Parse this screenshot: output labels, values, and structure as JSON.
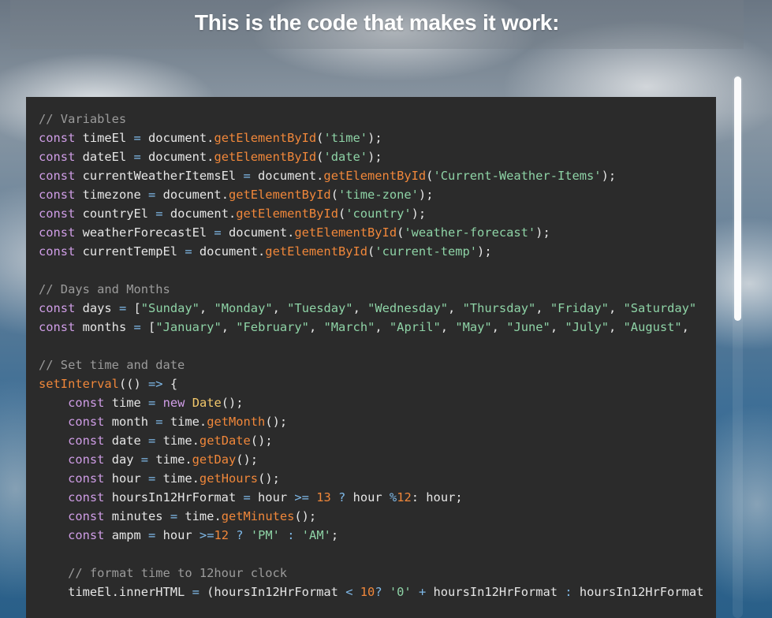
{
  "header": {
    "title": "This is the code that makes it work:"
  },
  "code": {
    "lines": [
      [
        {
          "t": "// Variables",
          "c": "comment"
        }
      ],
      [
        {
          "t": "const",
          "c": "keyword"
        },
        {
          "t": " timeEl ",
          "c": "plain"
        },
        {
          "t": "=",
          "c": "op"
        },
        {
          "t": " document.",
          "c": "plain"
        },
        {
          "t": "getElementById",
          "c": "fn"
        },
        {
          "t": "(",
          "c": "plain"
        },
        {
          "t": "'time'",
          "c": "string"
        },
        {
          "t": ");",
          "c": "plain"
        }
      ],
      [
        {
          "t": "const",
          "c": "keyword"
        },
        {
          "t": " dateEl ",
          "c": "plain"
        },
        {
          "t": "=",
          "c": "op"
        },
        {
          "t": " document.",
          "c": "plain"
        },
        {
          "t": "getElementById",
          "c": "fn"
        },
        {
          "t": "(",
          "c": "plain"
        },
        {
          "t": "'date'",
          "c": "string"
        },
        {
          "t": ");",
          "c": "plain"
        }
      ],
      [
        {
          "t": "const",
          "c": "keyword"
        },
        {
          "t": " currentWeatherItemsEl ",
          "c": "plain"
        },
        {
          "t": "=",
          "c": "op"
        },
        {
          "t": " document.",
          "c": "plain"
        },
        {
          "t": "getElementById",
          "c": "fn"
        },
        {
          "t": "(",
          "c": "plain"
        },
        {
          "t": "'Current-Weather-Items'",
          "c": "string"
        },
        {
          "t": ");",
          "c": "plain"
        }
      ],
      [
        {
          "t": "const",
          "c": "keyword"
        },
        {
          "t": " timezone ",
          "c": "plain"
        },
        {
          "t": "=",
          "c": "op"
        },
        {
          "t": " document.",
          "c": "plain"
        },
        {
          "t": "getElementById",
          "c": "fn"
        },
        {
          "t": "(",
          "c": "plain"
        },
        {
          "t": "'time-zone'",
          "c": "string"
        },
        {
          "t": ");",
          "c": "plain"
        }
      ],
      [
        {
          "t": "const",
          "c": "keyword"
        },
        {
          "t": " countryEl ",
          "c": "plain"
        },
        {
          "t": "=",
          "c": "op"
        },
        {
          "t": " document.",
          "c": "plain"
        },
        {
          "t": "getElementById",
          "c": "fn"
        },
        {
          "t": "(",
          "c": "plain"
        },
        {
          "t": "'country'",
          "c": "string"
        },
        {
          "t": ");",
          "c": "plain"
        }
      ],
      [
        {
          "t": "const",
          "c": "keyword"
        },
        {
          "t": " weatherForecastEl ",
          "c": "plain"
        },
        {
          "t": "=",
          "c": "op"
        },
        {
          "t": " document.",
          "c": "plain"
        },
        {
          "t": "getElementById",
          "c": "fn"
        },
        {
          "t": "(",
          "c": "plain"
        },
        {
          "t": "'weather-forecast'",
          "c": "string"
        },
        {
          "t": ");",
          "c": "plain"
        }
      ],
      [
        {
          "t": "const",
          "c": "keyword"
        },
        {
          "t": " currentTempEl ",
          "c": "plain"
        },
        {
          "t": "=",
          "c": "op"
        },
        {
          "t": " document.",
          "c": "plain"
        },
        {
          "t": "getElementById",
          "c": "fn"
        },
        {
          "t": "(",
          "c": "plain"
        },
        {
          "t": "'current-temp'",
          "c": "string"
        },
        {
          "t": ");",
          "c": "plain"
        }
      ],
      [],
      [
        {
          "t": "// Days and Months",
          "c": "comment"
        }
      ],
      [
        {
          "t": "const",
          "c": "keyword"
        },
        {
          "t": " days ",
          "c": "plain"
        },
        {
          "t": "=",
          "c": "op"
        },
        {
          "t": " [",
          "c": "plain"
        },
        {
          "t": "\"Sunday\"",
          "c": "string"
        },
        {
          "t": ", ",
          "c": "plain"
        },
        {
          "t": "\"Monday\"",
          "c": "string"
        },
        {
          "t": ", ",
          "c": "plain"
        },
        {
          "t": "\"Tuesday\"",
          "c": "string"
        },
        {
          "t": ", ",
          "c": "plain"
        },
        {
          "t": "\"Wednesday\"",
          "c": "string"
        },
        {
          "t": ", ",
          "c": "plain"
        },
        {
          "t": "\"Thursday\"",
          "c": "string"
        },
        {
          "t": ", ",
          "c": "plain"
        },
        {
          "t": "\"Friday\"",
          "c": "string"
        },
        {
          "t": ", ",
          "c": "plain"
        },
        {
          "t": "\"Saturday\"",
          "c": "string"
        }
      ],
      [
        {
          "t": "const",
          "c": "keyword"
        },
        {
          "t": " months ",
          "c": "plain"
        },
        {
          "t": "=",
          "c": "op"
        },
        {
          "t": " [",
          "c": "plain"
        },
        {
          "t": "\"January\"",
          "c": "string"
        },
        {
          "t": ", ",
          "c": "plain"
        },
        {
          "t": "\"February\"",
          "c": "string"
        },
        {
          "t": ", ",
          "c": "plain"
        },
        {
          "t": "\"March\"",
          "c": "string"
        },
        {
          "t": ", ",
          "c": "plain"
        },
        {
          "t": "\"April\"",
          "c": "string"
        },
        {
          "t": ", ",
          "c": "plain"
        },
        {
          "t": "\"May\"",
          "c": "string"
        },
        {
          "t": ", ",
          "c": "plain"
        },
        {
          "t": "\"June\"",
          "c": "string"
        },
        {
          "t": ", ",
          "c": "plain"
        },
        {
          "t": "\"July\"",
          "c": "string"
        },
        {
          "t": ", ",
          "c": "plain"
        },
        {
          "t": "\"August\"",
          "c": "string"
        },
        {
          "t": ",",
          "c": "plain"
        }
      ],
      [],
      [
        {
          "t": "// Set time and date",
          "c": "comment"
        }
      ],
      [
        {
          "t": "setInterval",
          "c": "fn"
        },
        {
          "t": "(() ",
          "c": "plain"
        },
        {
          "t": "=>",
          "c": "op"
        },
        {
          "t": " {",
          "c": "plain"
        }
      ],
      [
        {
          "t": "    ",
          "c": "plain"
        },
        {
          "t": "const",
          "c": "keyword"
        },
        {
          "t": " time ",
          "c": "plain"
        },
        {
          "t": "=",
          "c": "op"
        },
        {
          "t": " ",
          "c": "plain"
        },
        {
          "t": "new",
          "c": "keyword"
        },
        {
          "t": " ",
          "c": "plain"
        },
        {
          "t": "Date",
          "c": "class"
        },
        {
          "t": "();",
          "c": "plain"
        }
      ],
      [
        {
          "t": "    ",
          "c": "plain"
        },
        {
          "t": "const",
          "c": "keyword"
        },
        {
          "t": " month ",
          "c": "plain"
        },
        {
          "t": "=",
          "c": "op"
        },
        {
          "t": " time.",
          "c": "plain"
        },
        {
          "t": "getMonth",
          "c": "fn"
        },
        {
          "t": "();",
          "c": "plain"
        }
      ],
      [
        {
          "t": "    ",
          "c": "plain"
        },
        {
          "t": "const",
          "c": "keyword"
        },
        {
          "t": " date ",
          "c": "plain"
        },
        {
          "t": "=",
          "c": "op"
        },
        {
          "t": " time.",
          "c": "plain"
        },
        {
          "t": "getDate",
          "c": "fn"
        },
        {
          "t": "();",
          "c": "plain"
        }
      ],
      [
        {
          "t": "    ",
          "c": "plain"
        },
        {
          "t": "const",
          "c": "keyword"
        },
        {
          "t": " day ",
          "c": "plain"
        },
        {
          "t": "=",
          "c": "op"
        },
        {
          "t": " time.",
          "c": "plain"
        },
        {
          "t": "getDay",
          "c": "fn"
        },
        {
          "t": "();",
          "c": "plain"
        }
      ],
      [
        {
          "t": "    ",
          "c": "plain"
        },
        {
          "t": "const",
          "c": "keyword"
        },
        {
          "t": " hour ",
          "c": "plain"
        },
        {
          "t": "=",
          "c": "op"
        },
        {
          "t": " time.",
          "c": "plain"
        },
        {
          "t": "getHours",
          "c": "fn"
        },
        {
          "t": "();",
          "c": "plain"
        }
      ],
      [
        {
          "t": "    ",
          "c": "plain"
        },
        {
          "t": "const",
          "c": "keyword"
        },
        {
          "t": " hoursIn12HrFormat ",
          "c": "plain"
        },
        {
          "t": "=",
          "c": "op"
        },
        {
          "t": " hour ",
          "c": "plain"
        },
        {
          "t": ">=",
          "c": "op"
        },
        {
          "t": " ",
          "c": "plain"
        },
        {
          "t": "13",
          "c": "number"
        },
        {
          "t": " ",
          "c": "plain"
        },
        {
          "t": "?",
          "c": "op"
        },
        {
          "t": " hour ",
          "c": "plain"
        },
        {
          "t": "%",
          "c": "op"
        },
        {
          "t": "12",
          "c": "number"
        },
        {
          "t": ": hour;",
          "c": "plain"
        }
      ],
      [
        {
          "t": "    ",
          "c": "plain"
        },
        {
          "t": "const",
          "c": "keyword"
        },
        {
          "t": " minutes ",
          "c": "plain"
        },
        {
          "t": "=",
          "c": "op"
        },
        {
          "t": " time.",
          "c": "plain"
        },
        {
          "t": "getMinutes",
          "c": "fn"
        },
        {
          "t": "();",
          "c": "plain"
        }
      ],
      [
        {
          "t": "    ",
          "c": "plain"
        },
        {
          "t": "const",
          "c": "keyword"
        },
        {
          "t": " ampm ",
          "c": "plain"
        },
        {
          "t": "=",
          "c": "op"
        },
        {
          "t": " hour ",
          "c": "plain"
        },
        {
          "t": ">=",
          "c": "op"
        },
        {
          "t": "12",
          "c": "number"
        },
        {
          "t": " ",
          "c": "plain"
        },
        {
          "t": "?",
          "c": "op"
        },
        {
          "t": " ",
          "c": "plain"
        },
        {
          "t": "'PM'",
          "c": "string"
        },
        {
          "t": " ",
          "c": "plain"
        },
        {
          "t": ":",
          "c": "op"
        },
        {
          "t": " ",
          "c": "plain"
        },
        {
          "t": "'AM'",
          "c": "string"
        },
        {
          "t": ";",
          "c": "plain"
        }
      ],
      [],
      [
        {
          "t": "    ",
          "c": "plain"
        },
        {
          "t": "// format time to 12hour clock",
          "c": "comment"
        }
      ],
      [
        {
          "t": "    timeEl.innerHTML ",
          "c": "plain"
        },
        {
          "t": "=",
          "c": "op"
        },
        {
          "t": " (hoursIn12HrFormat ",
          "c": "plain"
        },
        {
          "t": "<",
          "c": "op"
        },
        {
          "t": " ",
          "c": "plain"
        },
        {
          "t": "10",
          "c": "number"
        },
        {
          "t": "? ",
          "c": "op"
        },
        {
          "t": "'0'",
          "c": "string"
        },
        {
          "t": " ",
          "c": "plain"
        },
        {
          "t": "+",
          "c": "op"
        },
        {
          "t": " hoursIn12HrFormat ",
          "c": "plain"
        },
        {
          "t": ":",
          "c": "op"
        },
        {
          "t": " hoursIn12HrFormat",
          "c": "plain"
        }
      ]
    ]
  }
}
